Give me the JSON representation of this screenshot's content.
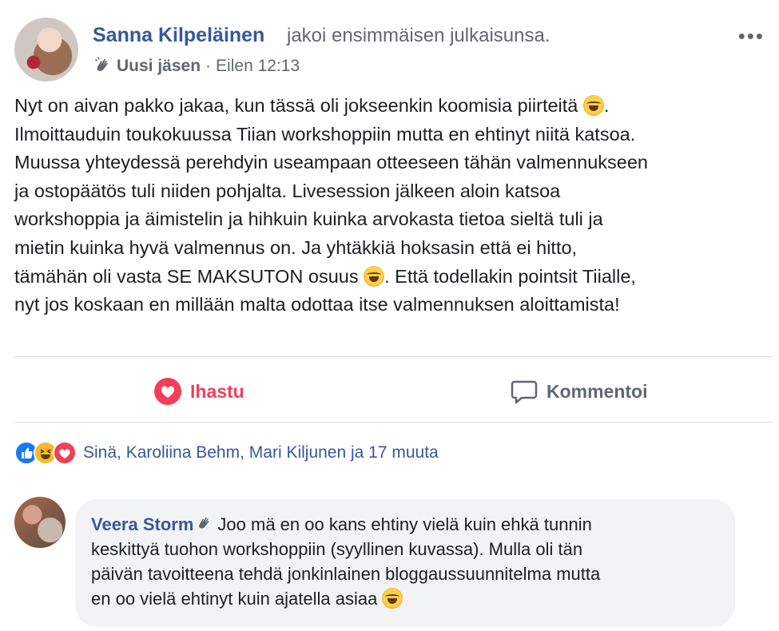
{
  "post": {
    "author_name": "Sanna Kilpeläinen",
    "action": "jakoi ensimmäisen julkaisunsa.",
    "badge": "Uusi jäsen",
    "separator": "·",
    "time": "Eilen 12:13",
    "more_label": "•••",
    "text_lines": [
      "Nyt on aivan pakko jakaa, kun tässä oli jokseenkin koomisia piirteitä",
      ".",
      "Ilmoittauduin toukokuussa Tiian workshoppiin mutta en ehtinyt niitä katsoa.",
      "Muussa yhteydessä perehdyin useampaan otteeseen tähän valmennukseen",
      "ja ostopäätös tuli niiden pohjalta. Livesession jälkeen aloin katsoa",
      "workshoppia ja äimistelin ja hihkuin kuinka arvokasta tietoa sieltä tuli ja",
      "mietin kuinka hyvä valmennus on. Ja yhtäkkiä hoksasin että ei hitto,",
      "tämähän oli vasta SE MAKSUTON osuus",
      ". Että todellakin pointsit Tiialle,",
      "nyt jos koskaan en millään malta odottaa itse valmennuksen aloittamista!"
    ],
    "emoji_icon": "laughing-tears-emoji"
  },
  "actions": {
    "like_label": "Ihastu",
    "comment_label": "Kommentoi",
    "like_color": "#f33e58",
    "comment_color": "#606770"
  },
  "reactions": {
    "icons": [
      "like-reaction-icon",
      "haha-reaction-icon",
      "love-reaction-icon"
    ],
    "summary": "Sinä, Karoliina Behm, Mari Kiljunen ja 17 muuta"
  },
  "comment": {
    "author": "Veera Storm",
    "line1": "Joo mä en oo kans ehtiny vielä kuin ehkä tunnin",
    "line2": "keskittyä tuohon workshoppiin (syyllinen kuvassa). Mulla oli tän",
    "line3": "päivän tavoitteena tehdä jonkinlainen bloggaussuunnitelma mutta",
    "line4": "en oo vielä ehtinyt kuin ajatella asiaa"
  },
  "colors": {
    "link": "#385898",
    "muted": "#606770",
    "bubble": "#f2f3f5"
  }
}
